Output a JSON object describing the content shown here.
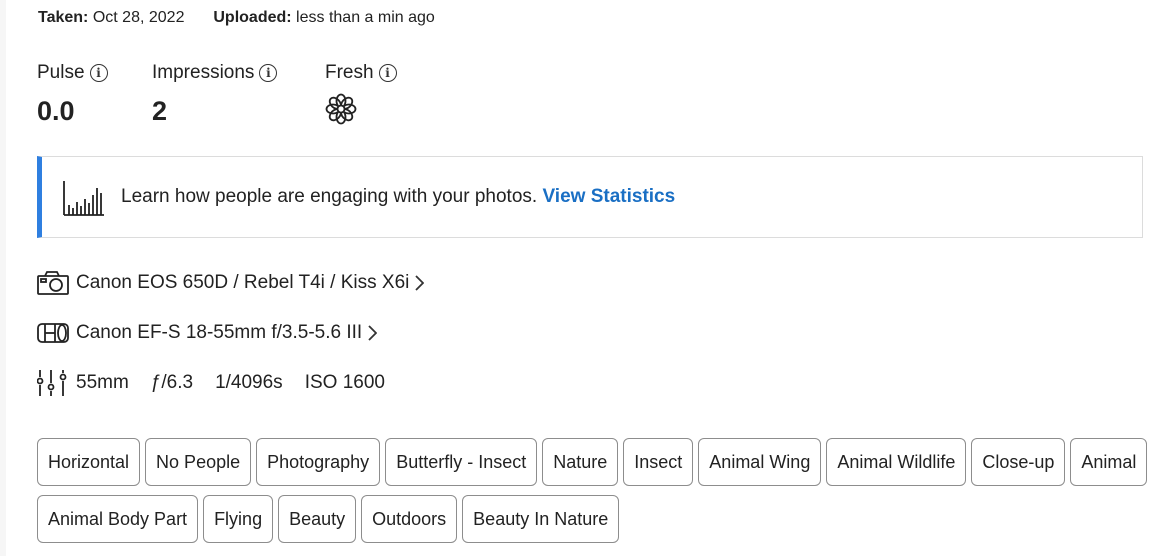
{
  "meta": {
    "taken_label": "Taken:",
    "taken_value": "Oct 28, 2022",
    "uploaded_label": "Uploaded:",
    "uploaded_value": "less than a min ago"
  },
  "stats": {
    "pulse": {
      "label": "Pulse",
      "value": "0.0"
    },
    "impressions": {
      "label": "Impressions",
      "value": "2"
    },
    "fresh": {
      "label": "Fresh",
      "icon": "flower-icon"
    }
  },
  "banner": {
    "icon": "bar-chart-icon",
    "text": "Learn how people are engaging with your photos.",
    "link": "View Statistics",
    "accent_color": "#2f7fe0",
    "link_color": "#1a6fc4"
  },
  "exif": {
    "camera": "Canon EOS 650D / Rebel T4i / Kiss X6i",
    "lens": "Canon EF-S 18-55mm f/3.5-5.6 III",
    "focal_length": "55mm",
    "aperture": "ƒ/6.3",
    "shutter": "1/4096s",
    "iso": "ISO 1600"
  },
  "tags": [
    [
      "Horizontal",
      "No People",
      "Photography",
      "Butterfly - Insect",
      "Nature",
      "Insect",
      "Animal Wing",
      "Animal Wildlife",
      "Close-up",
      "Animal"
    ],
    [
      "Animal Body Part",
      "Flying",
      "Beauty",
      "Outdoors",
      "Beauty In Nature"
    ]
  ]
}
